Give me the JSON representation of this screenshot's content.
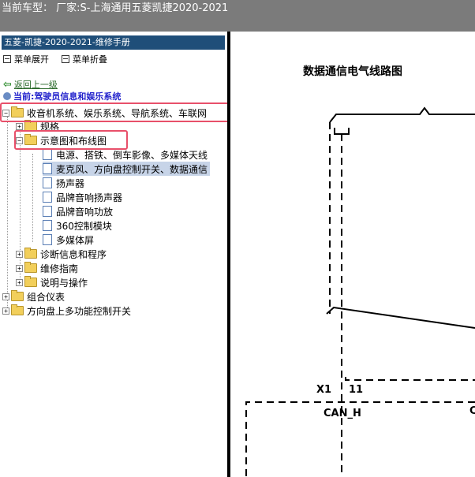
{
  "header": {
    "text": "当前车型：  厂家:S-上海通用五菱凯捷2020-2021"
  },
  "sidebar": {
    "manual_title": "五菱-凯捷-2020-2021-维修手册",
    "expand_label": "菜单展开",
    "collapse_label": "菜单折叠",
    "back_label": "返回上一级",
    "current_label": "当前:驾驶员信息和娱乐系统",
    "tree": {
      "n1": "收音机系统、娱乐系统、导航系统、车联网",
      "n2": "规格",
      "n3": "示意图和布线图",
      "n4": "电源、搭铁、倒车影像、多媒体天线",
      "n5": "麦克风、方向盘控制开关、数据通信",
      "n6": "扬声器",
      "n7": "品牌音响扬声器",
      "n8": "品牌音响功放",
      "n9": "360控制模块",
      "n10": "多媒体屏",
      "n11": "诊断信息和程序",
      "n12": "维修指南",
      "n13": "说明与操作",
      "n14": "组合仪表",
      "n15": "方向盘上多功能控制开关"
    }
  },
  "diagram": {
    "title": "数据通信电气线路图",
    "x1_label": "X1",
    "pin_label": "11",
    "can_label": "CAN_H",
    "edge_label": "C"
  }
}
